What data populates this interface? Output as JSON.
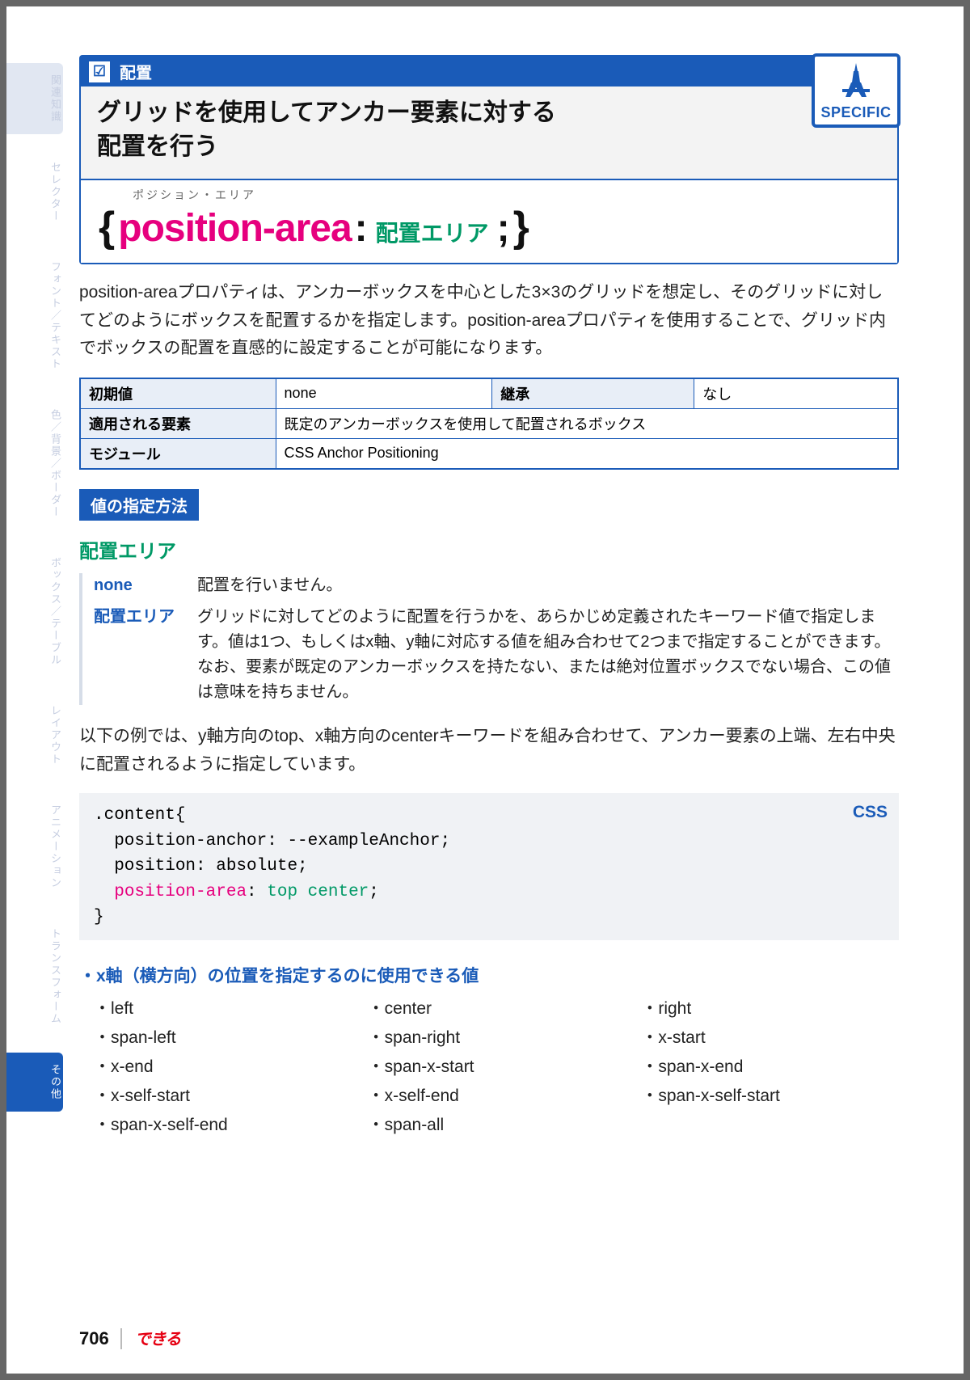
{
  "sidebar": {
    "tabs": [
      {
        "label": "関連知識"
      },
      {
        "label": "セレクター"
      },
      {
        "label": "フォント／テキスト"
      },
      {
        "label": "色／背景／ボーダー"
      },
      {
        "label": "ボックス／テーブル"
      },
      {
        "label": "レイアウト"
      },
      {
        "label": "アニメーション"
      },
      {
        "label": "トランスフォーム"
      },
      {
        "label": "その他"
      }
    ]
  },
  "header": {
    "category": "配置",
    "title_line1": "グリッドを使用してアンカー要素に対する",
    "title_line2": "配置を行う",
    "badge": "SPECIFIC",
    "ruby": "ポジション・エリア",
    "property_name": "position-area",
    "value_label": "配置エリア"
  },
  "intro": "position-areaプロパティは、アンカーボックスを中心とした3×3のグリッドを想定し、そのグリッドに対してどのようにボックスを配置するかを指定します。position-areaプロパティを使用することで、グリッド内でボックスの配置を直感的に設定することが可能になります。",
  "table": {
    "initial_label": "初期値",
    "initial_value": "none",
    "inherit_label": "継承",
    "inherit_value": "なし",
    "applies_label": "適用される要素",
    "applies_value": "既定のアンカーボックスを使用して配置されるボックス",
    "module_label": "モジュール",
    "module_value": "CSS Anchor Positioning"
  },
  "spec_section": "値の指定方法",
  "area_head": "配置エリア",
  "defs": [
    {
      "term": "none",
      "desc": "配置を行いません。"
    },
    {
      "term": "配置エリア",
      "desc": "グリッドに対してどのように配置を行うかを、あらかじめ定義されたキーワード値で指定します。値は1つ、もしくはx軸、y軸に対応する値を組み合わせて2つまで指定することができます。なお、要素が既定のアンカーボックスを持たない、または絶対位置ボックスでない場合、この値は意味を持ちません。"
    }
  ],
  "example_intro": "以下の例では、y軸方向のtop、x軸方向のcenterキーワードを組み合わせて、アンカー要素の上端、左右中央に配置されるように指定しています。",
  "code": {
    "lang": "CSS",
    "l1": ".content{",
    "l2": "  position-anchor: --exampleAnchor;",
    "l3": "  position: absolute;",
    "l4a": "  ",
    "l4_prop": "position-area",
    "l4_sep": ": ",
    "l4_val": "top center",
    "l4b": ";",
    "l5": "}"
  },
  "x_axis": {
    "heading": "・x軸（横方向）の位置を指定するのに使用できる値",
    "values": [
      "left",
      "center",
      "right",
      "span-left",
      "span-right",
      "x-start",
      "x-end",
      "span-x-start",
      "span-x-end",
      "x-self-start",
      "x-self-end",
      "span-x-self-start",
      "span-x-self-end",
      "span-all"
    ]
  },
  "footer": {
    "page": "706",
    "brand": "できる"
  }
}
